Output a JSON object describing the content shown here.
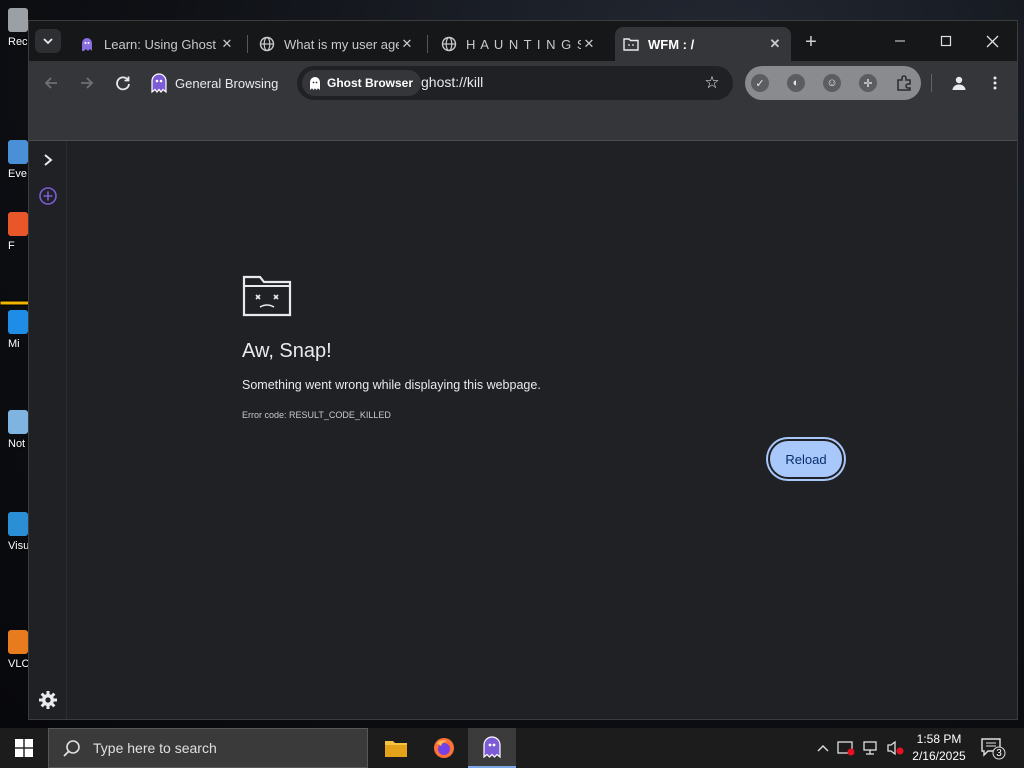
{
  "desktop": {
    "icons": [
      {
        "label": "Rec",
        "color": "#9aa0a6"
      },
      {
        "label": "Eve",
        "color": "#4a90d9"
      },
      {
        "label": "F",
        "color": "#e8562a"
      },
      {
        "label": "Mi",
        "color": "#1f8de6"
      },
      {
        "label": "Not",
        "color": "#7fb4e0"
      },
      {
        "label": "Visu",
        "color": "#2b8fd6"
      },
      {
        "label": "VLC",
        "color": "#e87b1e"
      }
    ]
  },
  "tabs": [
    {
      "title": "Learn: Using Ghost B",
      "icon": "ghost-icon",
      "close": "✕"
    },
    {
      "title": "What is my user age",
      "icon": "globe-icon",
      "close": "✕"
    },
    {
      "title": "H A U N T I N G S",
      "icon": "globe-icon",
      "close": "✕"
    },
    {
      "title": "WFM : /",
      "icon": "folder-icon",
      "close": "✕"
    }
  ],
  "toolbar": {
    "profile_label": "General Browsing",
    "omnibox_chip": "Ghost Browser",
    "url": "ghost://kill"
  },
  "page": {
    "heading": "Aw, Snap!",
    "message": "Something went wrong while displaying this webpage.",
    "error_code": "Error code: RESULT_CODE_KILLED",
    "reload_label": "Reload"
  },
  "taskbar": {
    "search_placeholder": "Type here to search",
    "time": "1:58 PM",
    "date": "2/16/2025",
    "notification_count": "3"
  },
  "colors": {
    "accent": "#a8c7fa",
    "ghost_purple": "#7c5cd6",
    "window_bg": "#202124",
    "toolbar_bg": "#35363a"
  }
}
